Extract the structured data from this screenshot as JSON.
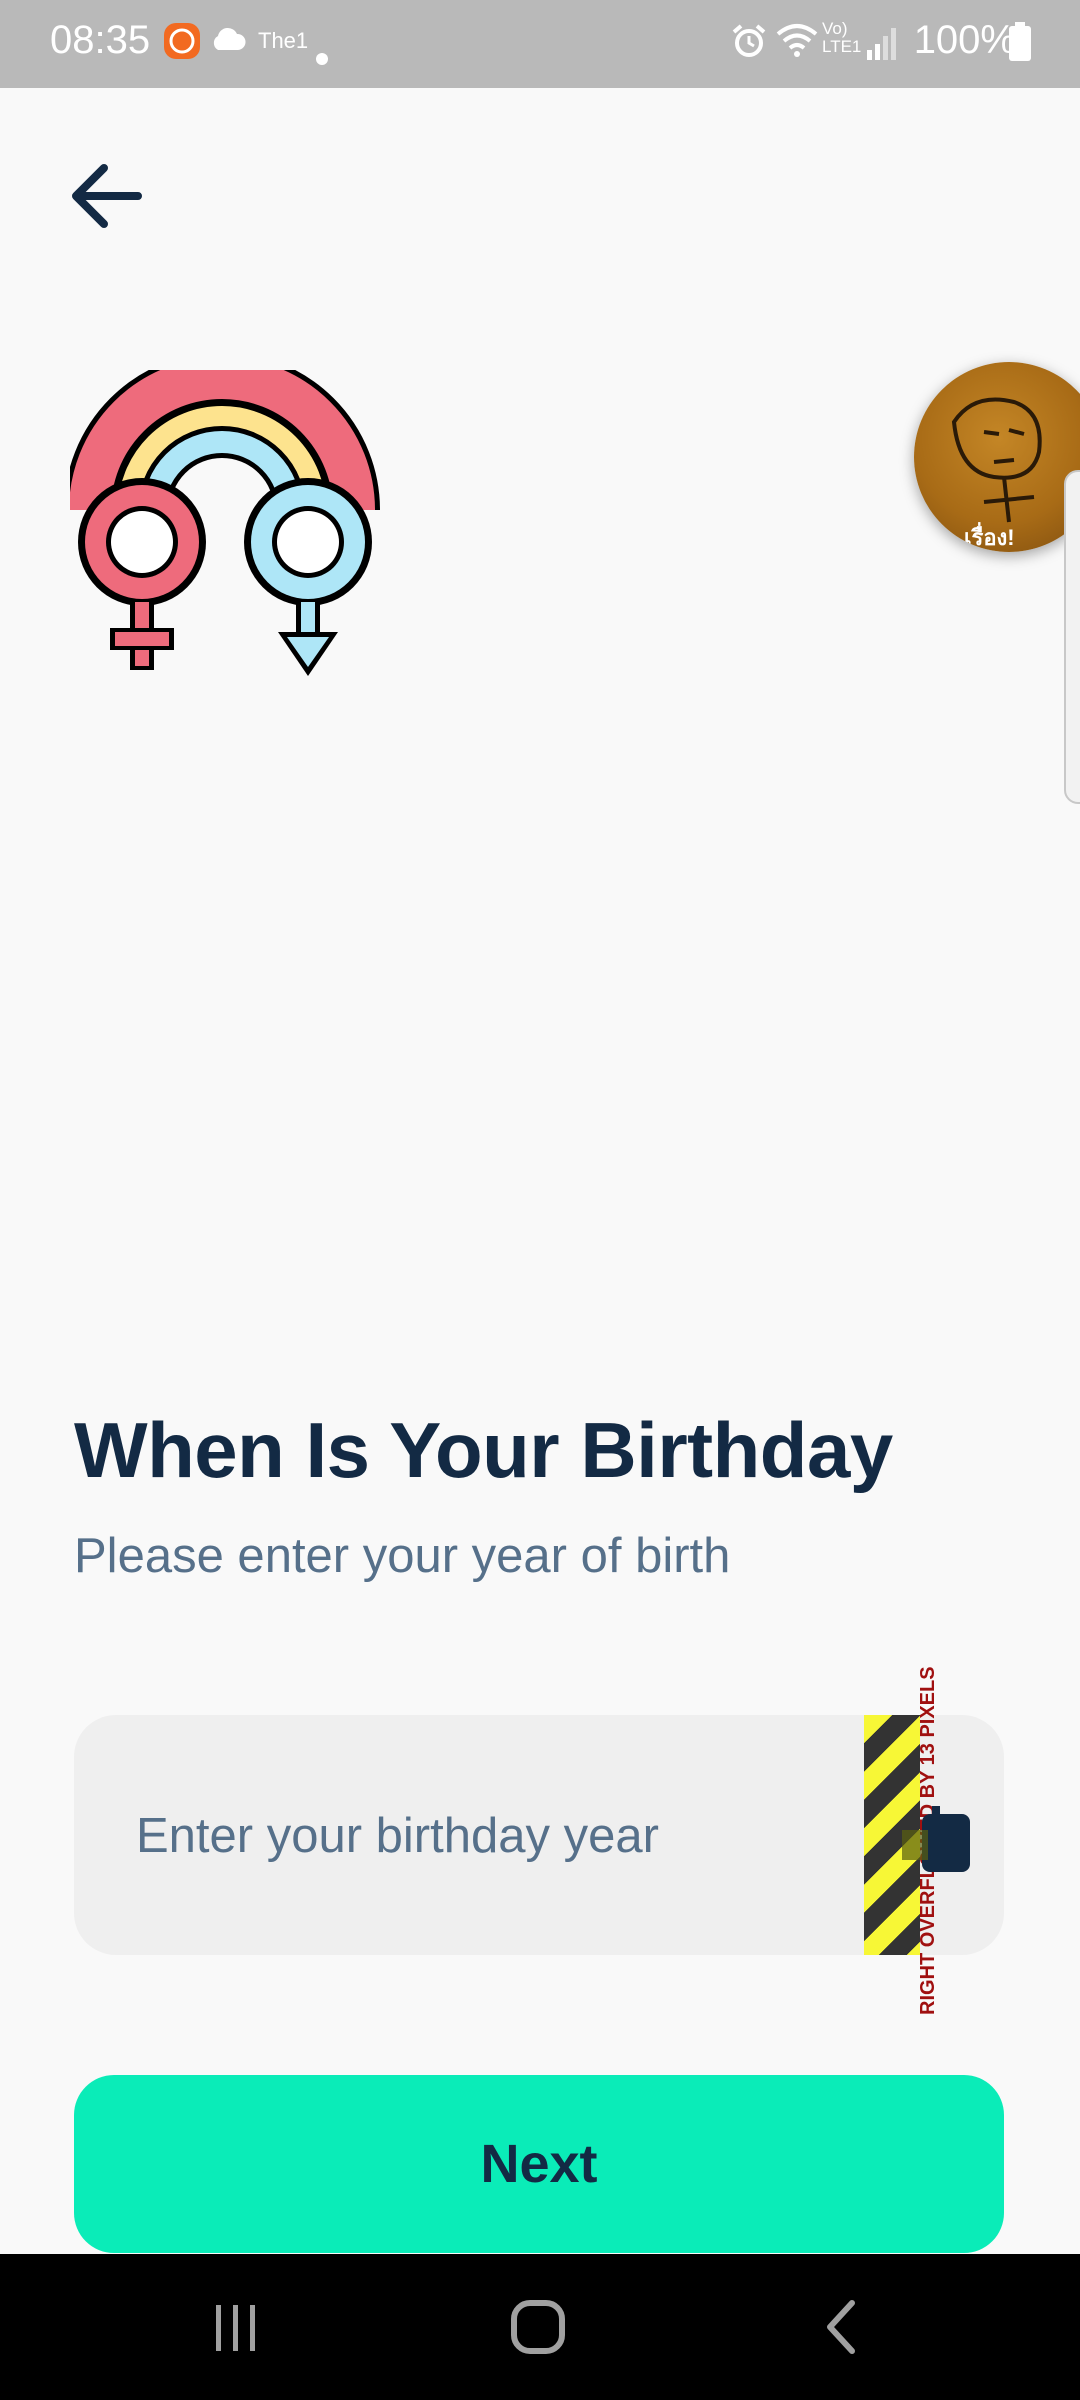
{
  "status_bar": {
    "time": "08:35",
    "carrier_label": "The1",
    "battery": "100%",
    "icons": [
      "mi-app-icon",
      "cloud-icon",
      "dot-icon",
      "alarm-icon",
      "wifi-icon",
      "volte-icon",
      "signal-icon",
      "battery-icon"
    ]
  },
  "header": {
    "back_icon": "arrow-left-icon"
  },
  "illustration": {
    "icon": "gender-rainbow-icon",
    "colors": {
      "rainbow_red": "#ee6b7c",
      "rainbow_yellow": "#fde38e",
      "rainbow_blue": "#aee6f7",
      "female": "#ee6b7c",
      "male": "#aee6f7"
    }
  },
  "floating_bubble": {
    "caption": "เรื่อง!"
  },
  "main": {
    "title": "When Is Your Birthday",
    "subtitle": "Please enter your year of birth",
    "birthday_input": {
      "placeholder": "Enter your birthday year",
      "value": ""
    },
    "overflow_warning": "RIGHT OVERFLOWED BY 13 PIXELS",
    "calendar_icon": "calendar-icon",
    "next_label": "Next"
  },
  "navigation": {
    "recents_icon": "recents-icon",
    "home_icon": "home-icon",
    "back_icon": "back-chevron-icon"
  },
  "colors": {
    "background": "#f9f9f9",
    "title": "#132a44",
    "subtitle": "#56708a",
    "accent": "#0aecb8",
    "input_bg": "#efefef"
  }
}
